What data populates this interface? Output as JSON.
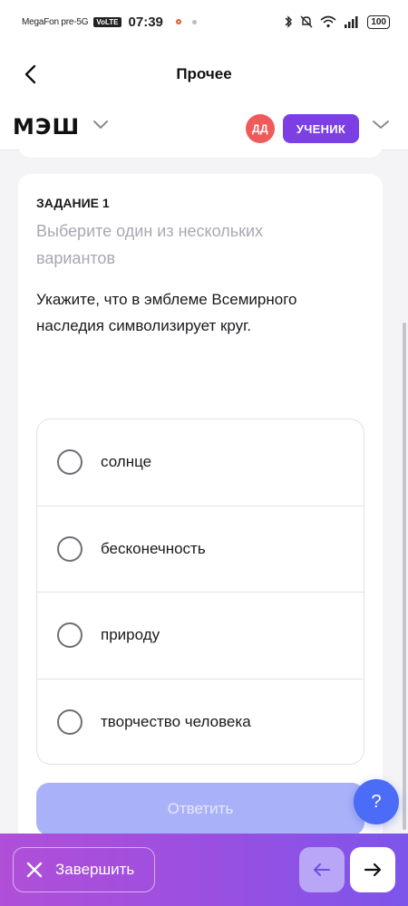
{
  "status_bar": {
    "carrier": "MegaFon pre-5G",
    "volte": "VoLTE",
    "time": "07:39",
    "battery": "100"
  },
  "header": {
    "title": "Прочее"
  },
  "brand": {
    "logo": "МЭШ",
    "avatar_initials": "ДД",
    "role": "УЧЕНИК"
  },
  "task": {
    "label": "ЗАДАНИЕ 1",
    "hint": "Выберите один из нескольких вариантов",
    "question": "Укажите, что в эмблеме Всемирного наследия символизирует круг.",
    "options": [
      {
        "label": "солнце"
      },
      {
        "label": "бесконечность"
      },
      {
        "label": "природу"
      },
      {
        "label": "творчество человека"
      }
    ],
    "submit_label": "Ответить"
  },
  "help": {
    "label": "?"
  },
  "bottom_bar": {
    "finish_label": "Завершить"
  },
  "colors": {
    "accent": "#7b3fe4",
    "submit_disabled": "#a9b2f9",
    "help": "#4a6cf7"
  }
}
